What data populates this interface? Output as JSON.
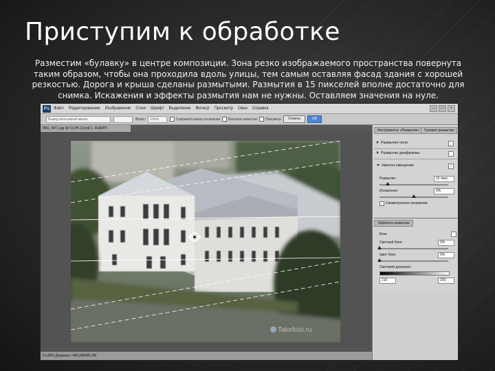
{
  "slide": {
    "title": "Приступим к обработке",
    "body": "Разместим «булавку» в центре композиции. Зона  резко изображаемого пространства повернута таким образом, чтобы она проходила вдоль улицы, тем самым оставляя фасад здания с хорошей резкостью. Дорога и крыша сделаны размытыми. Размытия в 15 пикселей вполне достаточно для снимка. Искажения и эффекты размытия нам не нужны. Оставляем значения на нуле."
  },
  "photoshop": {
    "logo": "Ps",
    "menu": [
      "Файл",
      "Редактирование",
      "Изображение",
      "Слои",
      "Шрифт",
      "Выделение",
      "Фильтр",
      "Просмотр",
      "Окно",
      "Справка"
    ],
    "window_controls": [
      "–",
      "□",
      "×"
    ],
    "options_bar": {
      "field": "Вывод монтажной маски",
      "focus_label": "Фокус:",
      "focus_value": "100%",
      "check1": "Сохранить маску в каналах",
      "check2": "Высокое качество",
      "preview_label": "Просмотр",
      "cancel_label": "Отмена",
      "ok_label": "OK"
    },
    "doc_tab": "IMG_4471.jpg @ 61,8% (Слой 1, RGB/8*)",
    "status_bar": "61,80%   Документ: 480,2M/480,2M",
    "panel": {
      "tab_main": "Инструменты «Размытие»",
      "tab_right": "Галерея размытия",
      "items": [
        {
          "label": "Размытие поля",
          "checked": false
        },
        {
          "label": "Размытие диафрагмы",
          "checked": false
        },
        {
          "label": "Наклон-смещение",
          "checked": true
        }
      ],
      "blur_label": "Размытие:",
      "blur_value": "15 пикс.",
      "distortion_label": "Искажение:",
      "distortion_value": "0%",
      "symmetric_label": "Симметричное искажение",
      "effects_tab": "Эффекты размытия",
      "bokeh_label": "Боке",
      "light_bokeh_label": "Светлый боке:",
      "light_bokeh_value": "0%",
      "bokeh_color_label": "Цвет боке:",
      "bokeh_color_value": "0%",
      "light_range_label": "Световой диапазон:",
      "range_low": "210",
      "range_high": "255"
    },
    "watermark": "Takefoto.ru"
  }
}
